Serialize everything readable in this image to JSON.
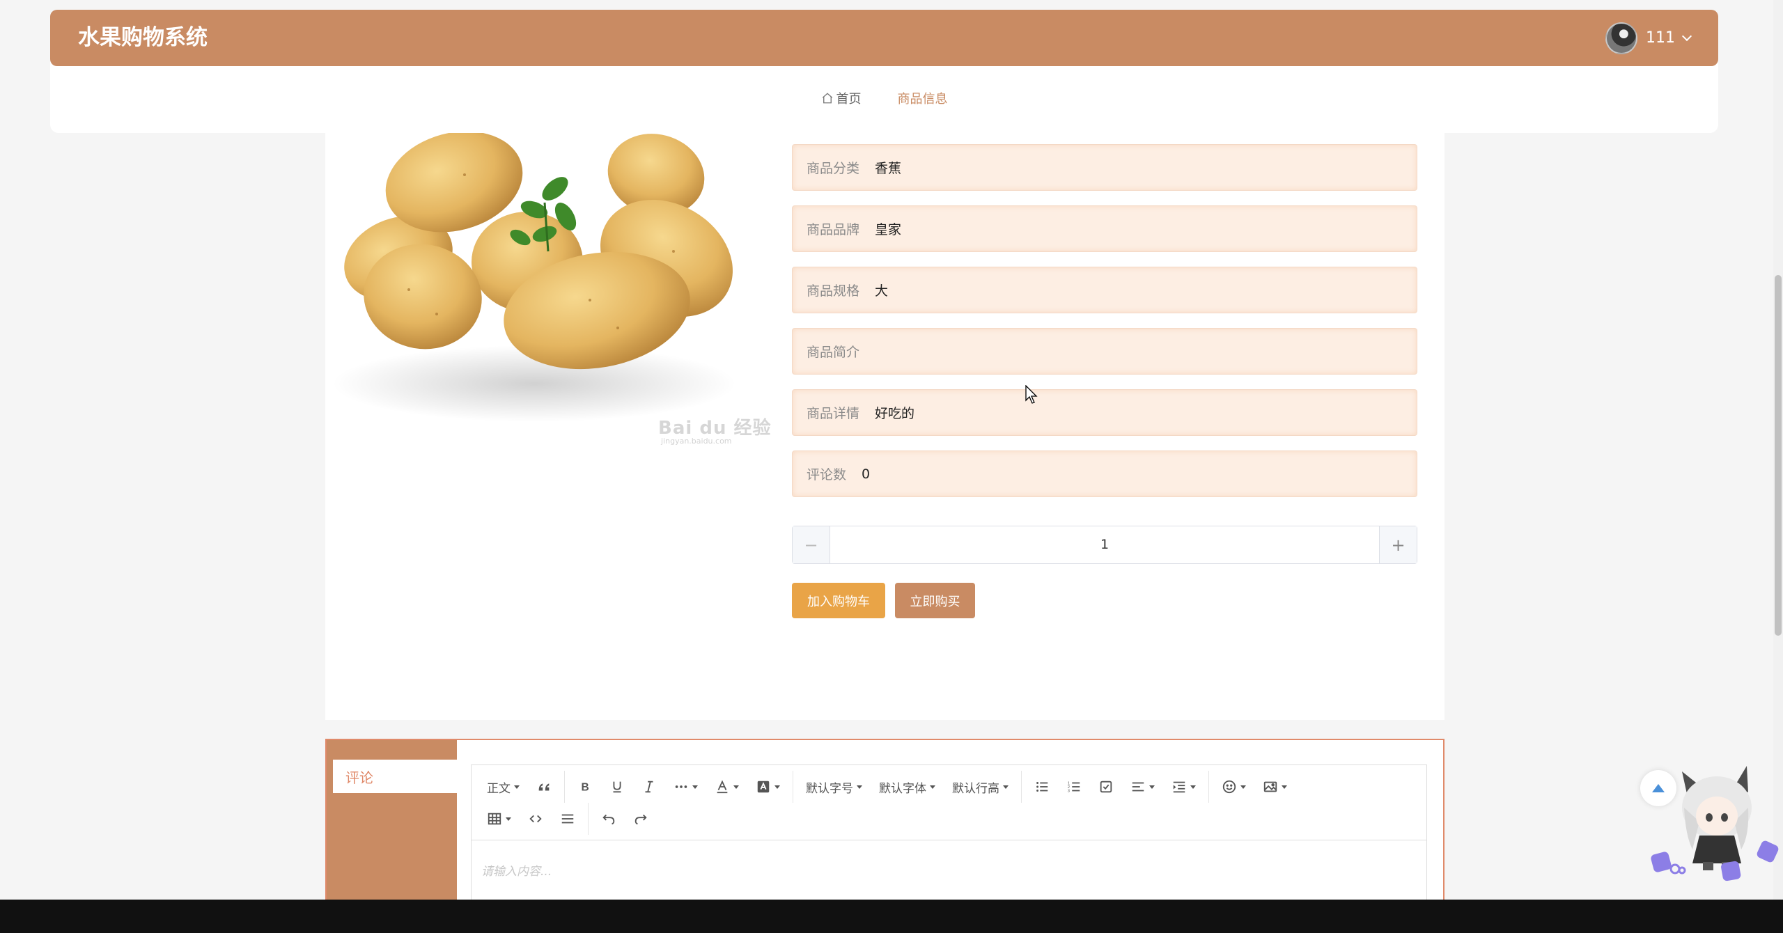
{
  "header": {
    "title": "水果购物系统",
    "username": "111"
  },
  "breadcrumb": {
    "home": "首页",
    "current": "商品信息"
  },
  "product": {
    "image_alt": "potatoes",
    "watermark": "Bai du 经验",
    "watermark_sub": "jingyan.baidu.com",
    "fields": [
      {
        "label": "商品分类",
        "value": "香蕉"
      },
      {
        "label": "商品品牌",
        "value": "皇家"
      },
      {
        "label": "商品规格",
        "value": "大"
      },
      {
        "label": "商品简介",
        "value": ""
      },
      {
        "label": "商品详情",
        "value": "好吃的"
      },
      {
        "label": "评论数",
        "value": "0"
      }
    ],
    "quantity": "1"
  },
  "actions": {
    "add_to_cart": "加入购物车",
    "buy_now": "立即购买"
  },
  "comments": {
    "tab_label": "评论",
    "editor_placeholder": "请输入内容...",
    "toolbar": {
      "paragraph": "正文",
      "font_size": "默认字号",
      "font_family": "默认字体",
      "line_height": "默认行高"
    }
  },
  "colors": {
    "brand": "#c98b63",
    "cart_button": "#e9a447",
    "field_bg": "#fdeee3",
    "accent_text": "#e08a6a"
  }
}
